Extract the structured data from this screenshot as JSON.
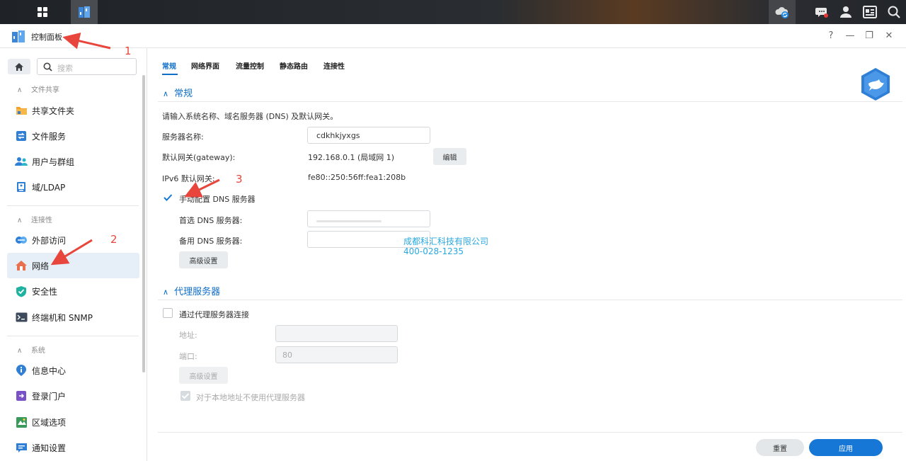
{
  "taskbar": {
    "icons": [
      "main-menu-icon",
      "control-panel-app-icon",
      "cloud-sync-icon",
      "chat-icon",
      "user-icon",
      "widgets-icon",
      "search-icon"
    ]
  },
  "window": {
    "title": "控制面板",
    "controls": {
      "help": "?",
      "minimize": "—",
      "restore": "❐",
      "close": "✕"
    }
  },
  "sidebar": {
    "search_placeholder": "搜索",
    "sections": [
      {
        "title": "文件共享",
        "items": [
          "共享文件夹",
          "文件服务",
          "用户与群组",
          "域/LDAP"
        ]
      },
      {
        "title": "连接性",
        "items": [
          "外部访问",
          "网络",
          "安全性",
          "终端机和 SNMP"
        ]
      },
      {
        "title": "系统",
        "items": [
          "信息中心",
          "登录门户",
          "区域选项",
          "通知设置"
        ]
      }
    ],
    "selected": "网络"
  },
  "tabs": [
    "常规",
    "网络界面",
    "流量控制",
    "静态路由",
    "连接性"
  ],
  "active_tab": "常规",
  "general": {
    "title": "常规",
    "description": "请输入系统名称、域名服务器 (DNS) 及默认网关。",
    "server_name_label": "服务器名称:",
    "server_name_value": "cdkhkjyxgs",
    "gateway_label": "默认网关(gateway):",
    "gateway_value": "192.168.0.1 (局域网 1)",
    "edit_button": "编辑",
    "ipv6_gateway_label": "IPv6 默认网关:",
    "ipv6_gateway_value": "fe80::250:56ff:fea1:208b",
    "manual_dns_label": "手动配置 DNS 服务器",
    "manual_dns_checked": true,
    "preferred_dns_label": "首选 DNS 服务器:",
    "preferred_dns_value": "",
    "alternate_dns_label": "备用 DNS 服务器:",
    "alternate_dns_value": "",
    "advanced_button": "高级设置"
  },
  "proxy": {
    "title": "代理服务器",
    "connect_label": "通过代理服务器连接",
    "connect_checked": false,
    "address_label": "地址:",
    "address_value": "",
    "port_label": "端口:",
    "port_value": "80",
    "advanced_button": "高级设置",
    "bypass_local_label": "对于本地地址不使用代理服务器",
    "bypass_local_checked": true
  },
  "footer": {
    "reset_button": "重置",
    "apply_button": "应用"
  },
  "watermark": {
    "line1": "成都科汇科技有限公司",
    "line2": "400-028-1235"
  },
  "annotations": [
    "1",
    "2",
    "3"
  ],
  "colors": {
    "accent": "#0f6ec5",
    "apply": "#1777d6",
    "annotation": "#e8453c",
    "selected_bg": "#e6eff7"
  }
}
